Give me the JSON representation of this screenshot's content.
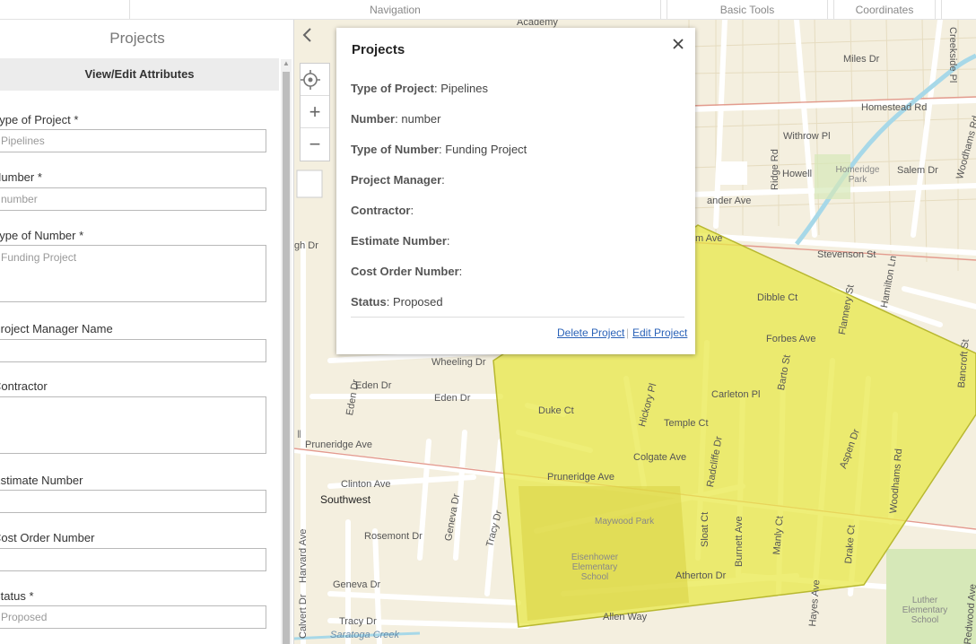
{
  "toolbar": {
    "tabs": [
      "Navigation",
      "Basic Tools",
      "Coordinates"
    ]
  },
  "panel": {
    "title": "Projects",
    "subtitle": "View/Edit Attributes",
    "fields": {
      "type_of_project": {
        "label": "Type of Project *",
        "value": "Pipelines"
      },
      "number": {
        "label": "Number *",
        "value": "number"
      },
      "type_of_number": {
        "label": "Type of Number *",
        "value": "Funding Project"
      },
      "project_manager": {
        "label": "Project Manager Name",
        "value": ""
      },
      "contractor": {
        "label": "Contractor",
        "value": ""
      },
      "estimate_number": {
        "label": "Estimate Number",
        "value": ""
      },
      "cost_order_number": {
        "label": "Cost Order Number",
        "value": ""
      },
      "status": {
        "label": "Status *",
        "value": "Proposed"
      }
    }
  },
  "map": {
    "collapse_icon": "chevron-left-icon",
    "locate_icon": "crosshair-icon",
    "zoom_in_label": "+",
    "zoom_out_label": "−",
    "polygon_color": "#e8e84a",
    "labels": {
      "academy": "Academy",
      "miles": "Miles Dr",
      "homestead": "Homestead  Rd",
      "creekside": "Creekside Pl",
      "withrow": "Withrow Pl",
      "howell": "Howell",
      "homeridge": "Homeridge Park",
      "salem": "Salem Dr",
      "woodhams_top": "Woodhams Rd",
      "ridge": "Ridge Rd",
      "lander": "ander Ave",
      "m_ave": "m Ave",
      "stevenson": "Stevenson St",
      "hamilton": "Hamilton Ln",
      "dibble": "Dibble Ct",
      "flannery": "Flannery St",
      "forbes": "Forbes Ave",
      "bancroft": "Bancroft St",
      "barto": "Barto St",
      "gh_dr": "gh Dr",
      "wheeling": "Wheeling Dr",
      "eden_dr": "Eden Dr",
      "eden_dr2": "Eden Dr",
      "eden_dr3": "Eden Dr",
      "duke": "Duke Ct",
      "hickory": "Hickory Pl",
      "carleton": "Carleton Pl",
      "temple": "Temple Ct",
      "radcliffe": "Radcliffe Dr",
      "aspen": "Aspen Dr",
      "woodhams": "Woodhams Rd",
      "pruneridge1": "Pruneridge Ave",
      "pruneridge2": "Pruneridge Ave",
      "colgate": "Colgate Ave",
      "clinton": "Clinton Ave",
      "southwest": "Southwest",
      "geneva_dr_v": "Geneva Dr",
      "tracy_dr_v": "Tracy Dr",
      "rosemont": "Rosemont Dr",
      "harvard": "Harvard Ave",
      "calvert": "Calvert Dr",
      "geneva": "Geneva Dr",
      "tracy": "Tracy Dr",
      "saratoga": "Saratoga Creek",
      "maywood": "Maywood Park",
      "eisenhower": "Eisenhower Elementary School",
      "sloat": "Sloat Ct",
      "burnett": "Burnett Ave",
      "manly": "Manly Ct",
      "drake": "Drake Ct",
      "atherton": "Atherton Dr",
      "allen": "Allen Way",
      "hayes": "Hayes Ave",
      "luther": "Luther Elementary School",
      "redwood": "Redwood Ave"
    }
  },
  "popup": {
    "title": "Projects",
    "close_icon": "close-icon",
    "rows": [
      {
        "key": "Type of Project",
        "value": "Pipelines"
      },
      {
        "key": "Number",
        "value": "number"
      },
      {
        "key": "Type of Number",
        "value": "Funding Project"
      },
      {
        "key": "Project Manager",
        "value": ""
      },
      {
        "key": "Contractor",
        "value": ""
      },
      {
        "key": "Estimate Number",
        "value": ""
      },
      {
        "key": "Cost Order Number",
        "value": ""
      },
      {
        "key": "Status",
        "value": "Proposed"
      }
    ],
    "delete_label": "Delete Project",
    "edit_label": "Edit Project"
  }
}
